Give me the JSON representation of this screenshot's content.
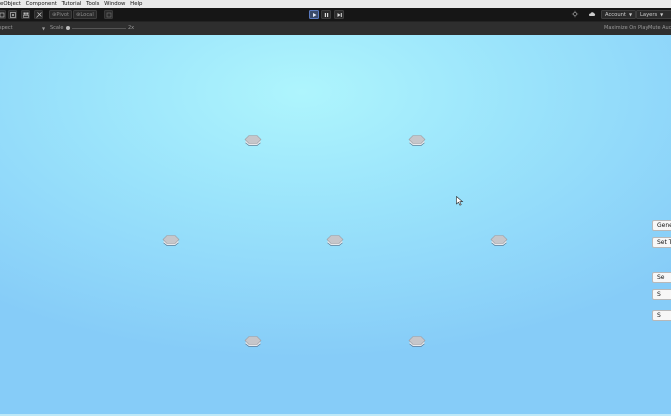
{
  "menu": {
    "items": [
      "eObject",
      "Component",
      "Tutorial",
      "Tools",
      "Window",
      "Help"
    ]
  },
  "toolbar": {
    "pivot_label": "Pivot",
    "space_label": "Local",
    "account_label": "Account",
    "layers_label": "Layers",
    "play_state": "playing"
  },
  "game_view": {
    "aspect_label": "spect",
    "scale_label": "Scale",
    "scale_value": "2x",
    "maximize_label": "Maximize On Play",
    "mute_label": "Mute Audi"
  },
  "scene": {
    "background_color": "#a2e9fb",
    "node_color": "#c8c8cc",
    "node_count": 7,
    "side_buttons": [
      "Gene",
      "Set T",
      "Se",
      "S",
      "S"
    ]
  }
}
